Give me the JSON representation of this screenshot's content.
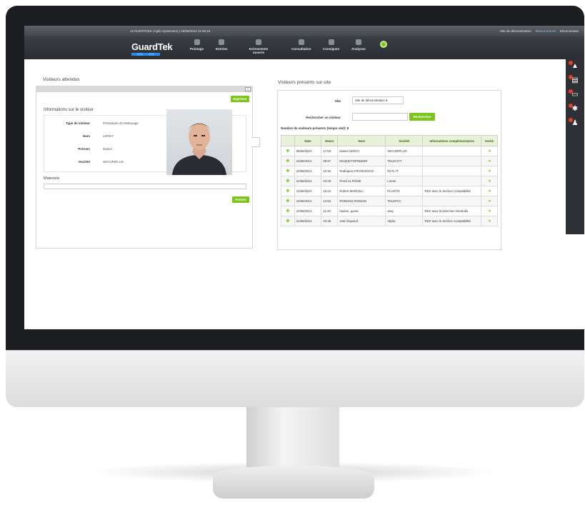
{
  "status_bar": {
    "center_text": "ALTIUMTRTEK (Agile Systemum) | 25/06/2014 11:00:16",
    "right_site": "Site de démonstration",
    "right_link": "Retour à la v3",
    "right_logout": "Déconnexion"
  },
  "nav": {
    "logo_text": "GuardTek",
    "items": [
      "Pointage",
      "Entrées",
      "Evènements ouverts",
      "Consultation",
      "Consignes",
      "Analyses"
    ]
  },
  "left": {
    "title": "Visiteurs attendus",
    "print_button": "Imprimer",
    "info_title": "Informations sur le visiteur",
    "fields": [
      {
        "label": "Type de visiteur",
        "value": "Prestataire de Nettoyage"
      },
      {
        "label": "Nom",
        "value": "LEROY"
      },
      {
        "label": "Prénom",
        "value": "Daniel"
      },
      {
        "label": "Société",
        "value": "SECURIPLUS"
      }
    ],
    "materials_title": "Materiels",
    "close_button": "Fermer"
  },
  "right": {
    "title": "Visiteurs présents sur site",
    "site_label": "Site",
    "site_value": "Site de démonstration",
    "search_label": "Rechercher un visiteur",
    "search_button": "Rechercher",
    "count_text": "Nombre de visiteurs présents (temps réel): 8",
    "columns": [
      "",
      "Date",
      "Heure",
      "Nom",
      "Société",
      "Informations complémentaires",
      "Sortie"
    ],
    "rows": [
      {
        "date": "05/06/2014",
        "time": "17:03",
        "name": "Daniel LEROY",
        "company": "SECURIPLUS",
        "info": ""
      },
      {
        "date": "22/06/2014",
        "time": "09:57",
        "name": "MAQUETOPINNIER",
        "company": "TELECITY",
        "info": ""
      },
      {
        "date": "22/06/2014",
        "time": "10:32",
        "name": "Rodriguez FRANCESCO",
        "company": "NATL.IT",
        "info": ""
      },
      {
        "date": "22/06/2014",
        "time": "10:32",
        "name": "PASCAL RONE",
        "company": "Lorner",
        "info": ""
      },
      {
        "date": "14/06/2014",
        "time": "10:21",
        "name": "Robert MARCELI",
        "company": "PLASTIX",
        "info": "RDV avec le Service Comptabilité"
      },
      {
        "date": "16/06/2014",
        "time": "14:53",
        "name": "ROMANO ROMAIN",
        "company": "TELEPAC",
        "info": ""
      },
      {
        "date": "23/06/2014",
        "time": "11:33",
        "name": "hadoni, guma",
        "company": "amg",
        "info": "RDV avec la Direction Générale"
      },
      {
        "date": "24/06/2014",
        "time": "10:36",
        "name": "Jean Dupond",
        "company": "Alpha",
        "info": "RDV avec le Service Comptabilité"
      }
    ]
  },
  "sidebar": {
    "icons": [
      "alert-icon",
      "clipboard-icon",
      "id-card-icon",
      "badge-icon",
      "person-icon"
    ]
  }
}
